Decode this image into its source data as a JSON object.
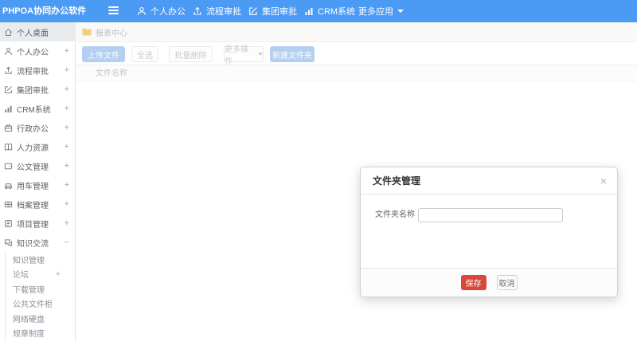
{
  "app": {
    "title": "PHPOA协同办公软件"
  },
  "navbar": {
    "items": [
      {
        "label": "个人办公",
        "icon": "user-icon"
      },
      {
        "label": "流程审批",
        "icon": "flow-icon"
      },
      {
        "label": "集团审批",
        "icon": "edit-icon"
      },
      {
        "label": "CRM系统",
        "icon": "chart-icon"
      },
      {
        "label": "更多应用",
        "icon": "caret-down-icon"
      }
    ]
  },
  "sidebar": {
    "items": [
      {
        "label": "个人桌面",
        "marker": ""
      },
      {
        "label": "个人办公",
        "marker": "+"
      },
      {
        "label": "流程审批",
        "marker": "+"
      },
      {
        "label": "集团审批",
        "marker": "+"
      },
      {
        "label": "CRM系统",
        "marker": "+"
      },
      {
        "label": "行政办公",
        "marker": "+"
      },
      {
        "label": "人力资源",
        "marker": "+"
      },
      {
        "label": "公文管理",
        "marker": "+"
      },
      {
        "label": "用车管理",
        "marker": "+"
      },
      {
        "label": "档案管理",
        "marker": "+"
      },
      {
        "label": "项目管理",
        "marker": "+"
      },
      {
        "label": "知识交流",
        "marker": "−"
      }
    ],
    "subitems": [
      {
        "label": "知识管理",
        "marker": ""
      },
      {
        "label": "论坛",
        "marker": "+"
      },
      {
        "label": "下载管理",
        "marker": ""
      },
      {
        "label": "公共文件柜",
        "marker": ""
      },
      {
        "label": "网络硬盘",
        "marker": ""
      },
      {
        "label": "规章制度",
        "marker": ""
      }
    ]
  },
  "breadcrumb": {
    "label": "报表中心"
  },
  "toolbar": {
    "upload": "上传文件",
    "select_all": "全选",
    "batch_delete": "批量删除",
    "more": "更多操作",
    "new_folder": "新建文件夹"
  },
  "table": {
    "name_header": "文件名称"
  },
  "modal": {
    "title": "文件夹管理",
    "close": "×",
    "field_label": "文件夹名称",
    "input_value": "",
    "save": "保存",
    "cancel": "取消"
  },
  "colors": {
    "navbar_blue": "#4b9af4",
    "faded_primary_button": "#b4cff2",
    "danger_red": "#d9483b",
    "folder_yellow": "#f0cf7e"
  }
}
